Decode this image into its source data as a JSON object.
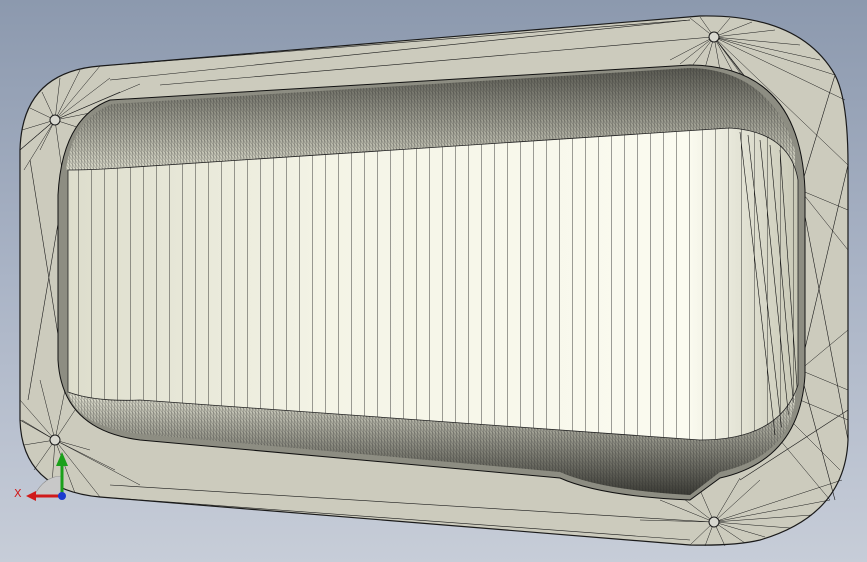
{
  "viewport": {
    "background_top": "#8c99ae",
    "background_bottom": "#c7cdd8"
  },
  "model": {
    "flange_color": "#cccbbd",
    "cavity_color": "#f1f1e4",
    "edge_color": "#1a1a1a",
    "icon": "sheet-metal-part-mesh"
  },
  "triad": {
    "x_label": "X",
    "x_color": "#d01a1a",
    "y_color": "#1aa01a",
    "z_color": "#1a3ad0"
  }
}
